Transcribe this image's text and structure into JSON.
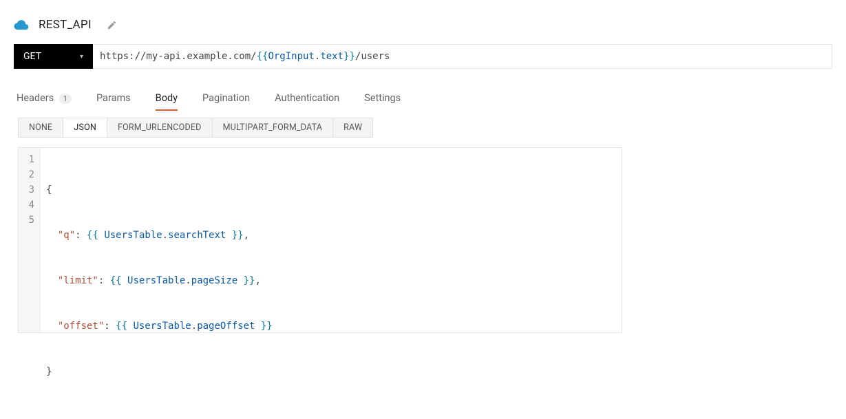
{
  "header": {
    "api_name": "REST_API",
    "cloud_icon": "cloud-icon",
    "edit_icon": "pencil-icon"
  },
  "request": {
    "method": "GET",
    "url": {
      "prefix": "https://my-api.example.com/",
      "open": "{{ ",
      "obj": "OrgInput",
      "dot": ".",
      "prop": "text",
      "close": " }}",
      "suffix": "/users"
    }
  },
  "tabs": [
    {
      "label": "Headers",
      "count": "1",
      "active": false
    },
    {
      "label": "Params",
      "active": false
    },
    {
      "label": "Body",
      "active": true
    },
    {
      "label": "Pagination",
      "active": false
    },
    {
      "label": "Authentication",
      "active": false
    },
    {
      "label": "Settings",
      "active": false
    }
  ],
  "body_subtabs": [
    {
      "label": "NONE",
      "active": false
    },
    {
      "label": "JSON",
      "active": true
    },
    {
      "label": "FORM_URLENCODED",
      "active": false
    },
    {
      "label": "MULTIPART_FORM_DATA",
      "active": false
    },
    {
      "label": "RAW",
      "active": false
    }
  ],
  "editor": {
    "lines": [
      {
        "n": "1",
        "type": "open",
        "text_open": "{"
      },
      {
        "n": "2",
        "type": "kv",
        "indent": "  ",
        "key": "\"q\"",
        "colon": ": ",
        "open": "{{ ",
        "obj": "UsersTable",
        "dot": ".",
        "prop": "searchText",
        "close": " }}",
        "trail": ","
      },
      {
        "n": "3",
        "type": "kv",
        "indent": "  ",
        "key": "\"limit\"",
        "colon": ": ",
        "open": "{{ ",
        "obj": "UsersTable",
        "dot": ".",
        "prop": "pageSize",
        "close": " }}",
        "trail": ","
      },
      {
        "n": "4",
        "type": "kv",
        "indent": "  ",
        "key": "\"offset\"",
        "colon": ": ",
        "open": "{{ ",
        "obj": "UsersTable",
        "dot": ".",
        "prop": "pageOffset",
        "close": " }}",
        "trail": ""
      },
      {
        "n": "5",
        "type": "close",
        "text_close": "}"
      }
    ]
  }
}
